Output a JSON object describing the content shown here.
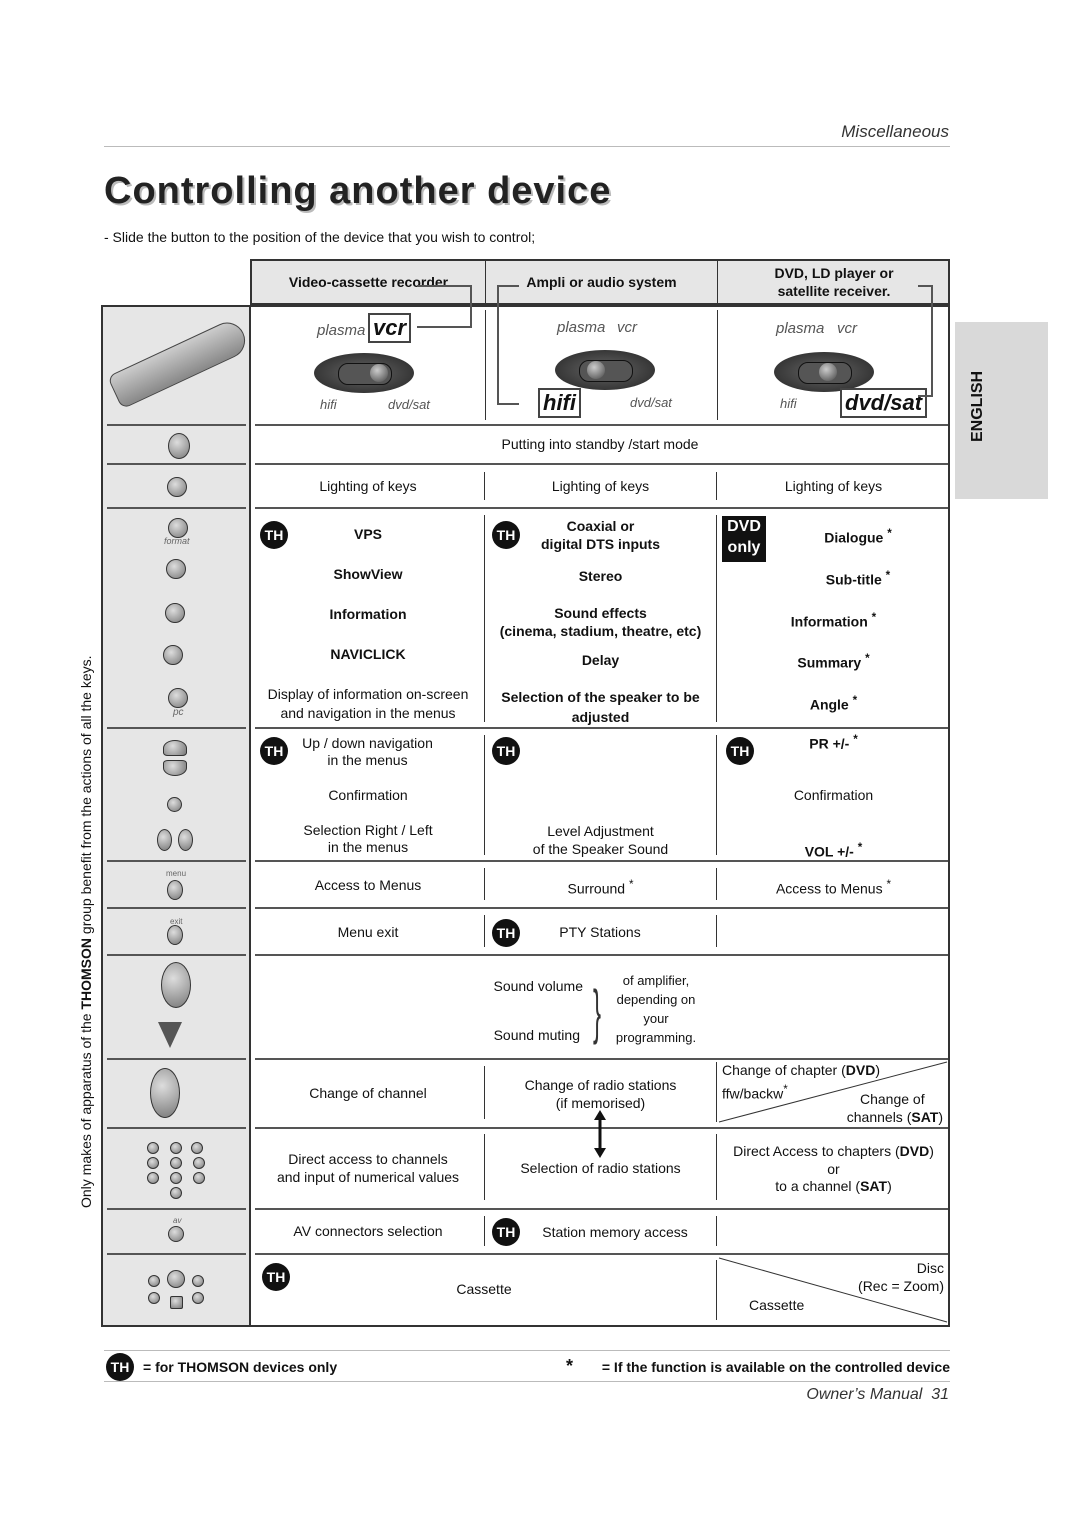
{
  "header": {
    "section": "Miscellaneous",
    "title": "Controlling another device",
    "intro": "-  Slide the button to the position of the device that you wish to control;"
  },
  "side_tab": "ENGLISH",
  "vertical_note": {
    "before": "Only makes of apparatus of the ",
    "brand": "THOMSON",
    "after": " group benefit from the actions of all the keys."
  },
  "columns": [
    "Video-cassette recorder",
    "Ampli or audio system",
    "DVD, LD player or",
    "satellite receiver."
  ],
  "switch_labels": {
    "plasma": "plasma",
    "vcr": "vcr",
    "hifi": "hifi",
    "dvdsat": "dvd/sat"
  },
  "badge": {
    "th": "TH",
    "dvd": "DVD",
    "only": "only"
  },
  "rows": {
    "standby": "Putting into standby /start mode",
    "lighting": "Lighting of keys",
    "key_format": "format",
    "key_pc": "pc",
    "key_menu": "menu",
    "key_exit": "exit",
    "key_av": "av",
    "vps": "VPS",
    "showview": "ShowView",
    "information": "Information",
    "naviclick": "NAVICLICK",
    "display1": "Display of information on-screen",
    "display2": "and navigation in the menus",
    "coax1": "Coaxial or",
    "coax2": "digital DTS inputs",
    "stereo": "Stereo",
    "effects": "Sound effects",
    "effects2": "(cinema, stadium, theatre, etc)",
    "delay": "Delay",
    "speaker1": "Selection of the speaker to be",
    "speaker2": "adjusted",
    "dialogue": "Dialogue",
    "subtitle": "Sub-title",
    "info_dvd": "Information",
    "summary": "Summary",
    "angle": "Angle",
    "star": "*",
    "updown1": "Up / down navigation",
    "updown2": "in the menus",
    "confirmation": "Confirmation",
    "selrl1": "Selection Right / Left",
    "selrl2": "in the menus",
    "level1": "Level Adjustment",
    "level2": "of the Speaker Sound",
    "pr": "PR +/-",
    "vol": "VOL +/-",
    "access_menus": "Access to Menus",
    "surround": "Surround",
    "menu_exit": "Menu exit",
    "pty": "PTY Stations",
    "sound_volume": "Sound volume",
    "sound_muting": "Sound muting",
    "amp1": "of amplifier,",
    "amp2": "depending on",
    "amp3": "your",
    "amp4": "programming.",
    "change_channel": "Change of channel",
    "radio1": "Change of radio stations",
    "radio2": "(if memorised)",
    "chapter": "Change of chapter (",
    "dvd": "DVD",
    ")": ")",
    "ffw": "ffw/backw",
    "chg_of": "Change of",
    "channels": "channels (",
    "sat": "SAT",
    "direct1": "Direct access to channels",
    "direct2": "and input of numerical values",
    "sel_radio": "Selection of radio stations",
    "dac1": "Direct Access to chapters (",
    "or": "or",
    "dac3": "to a channel (",
    "av_sel": "AV connectors selection",
    "station_mem": "Station memory access",
    "cassette": "Cassette",
    "disc": "Disc",
    "rec_zoom": "(Rec = Zoom)"
  },
  "footer": {
    "th_note": "= for THOMSON devices only",
    "star_note": "= If the function is available on the controlled device",
    "manual": "Owner’s Manual",
    "page": "31"
  }
}
